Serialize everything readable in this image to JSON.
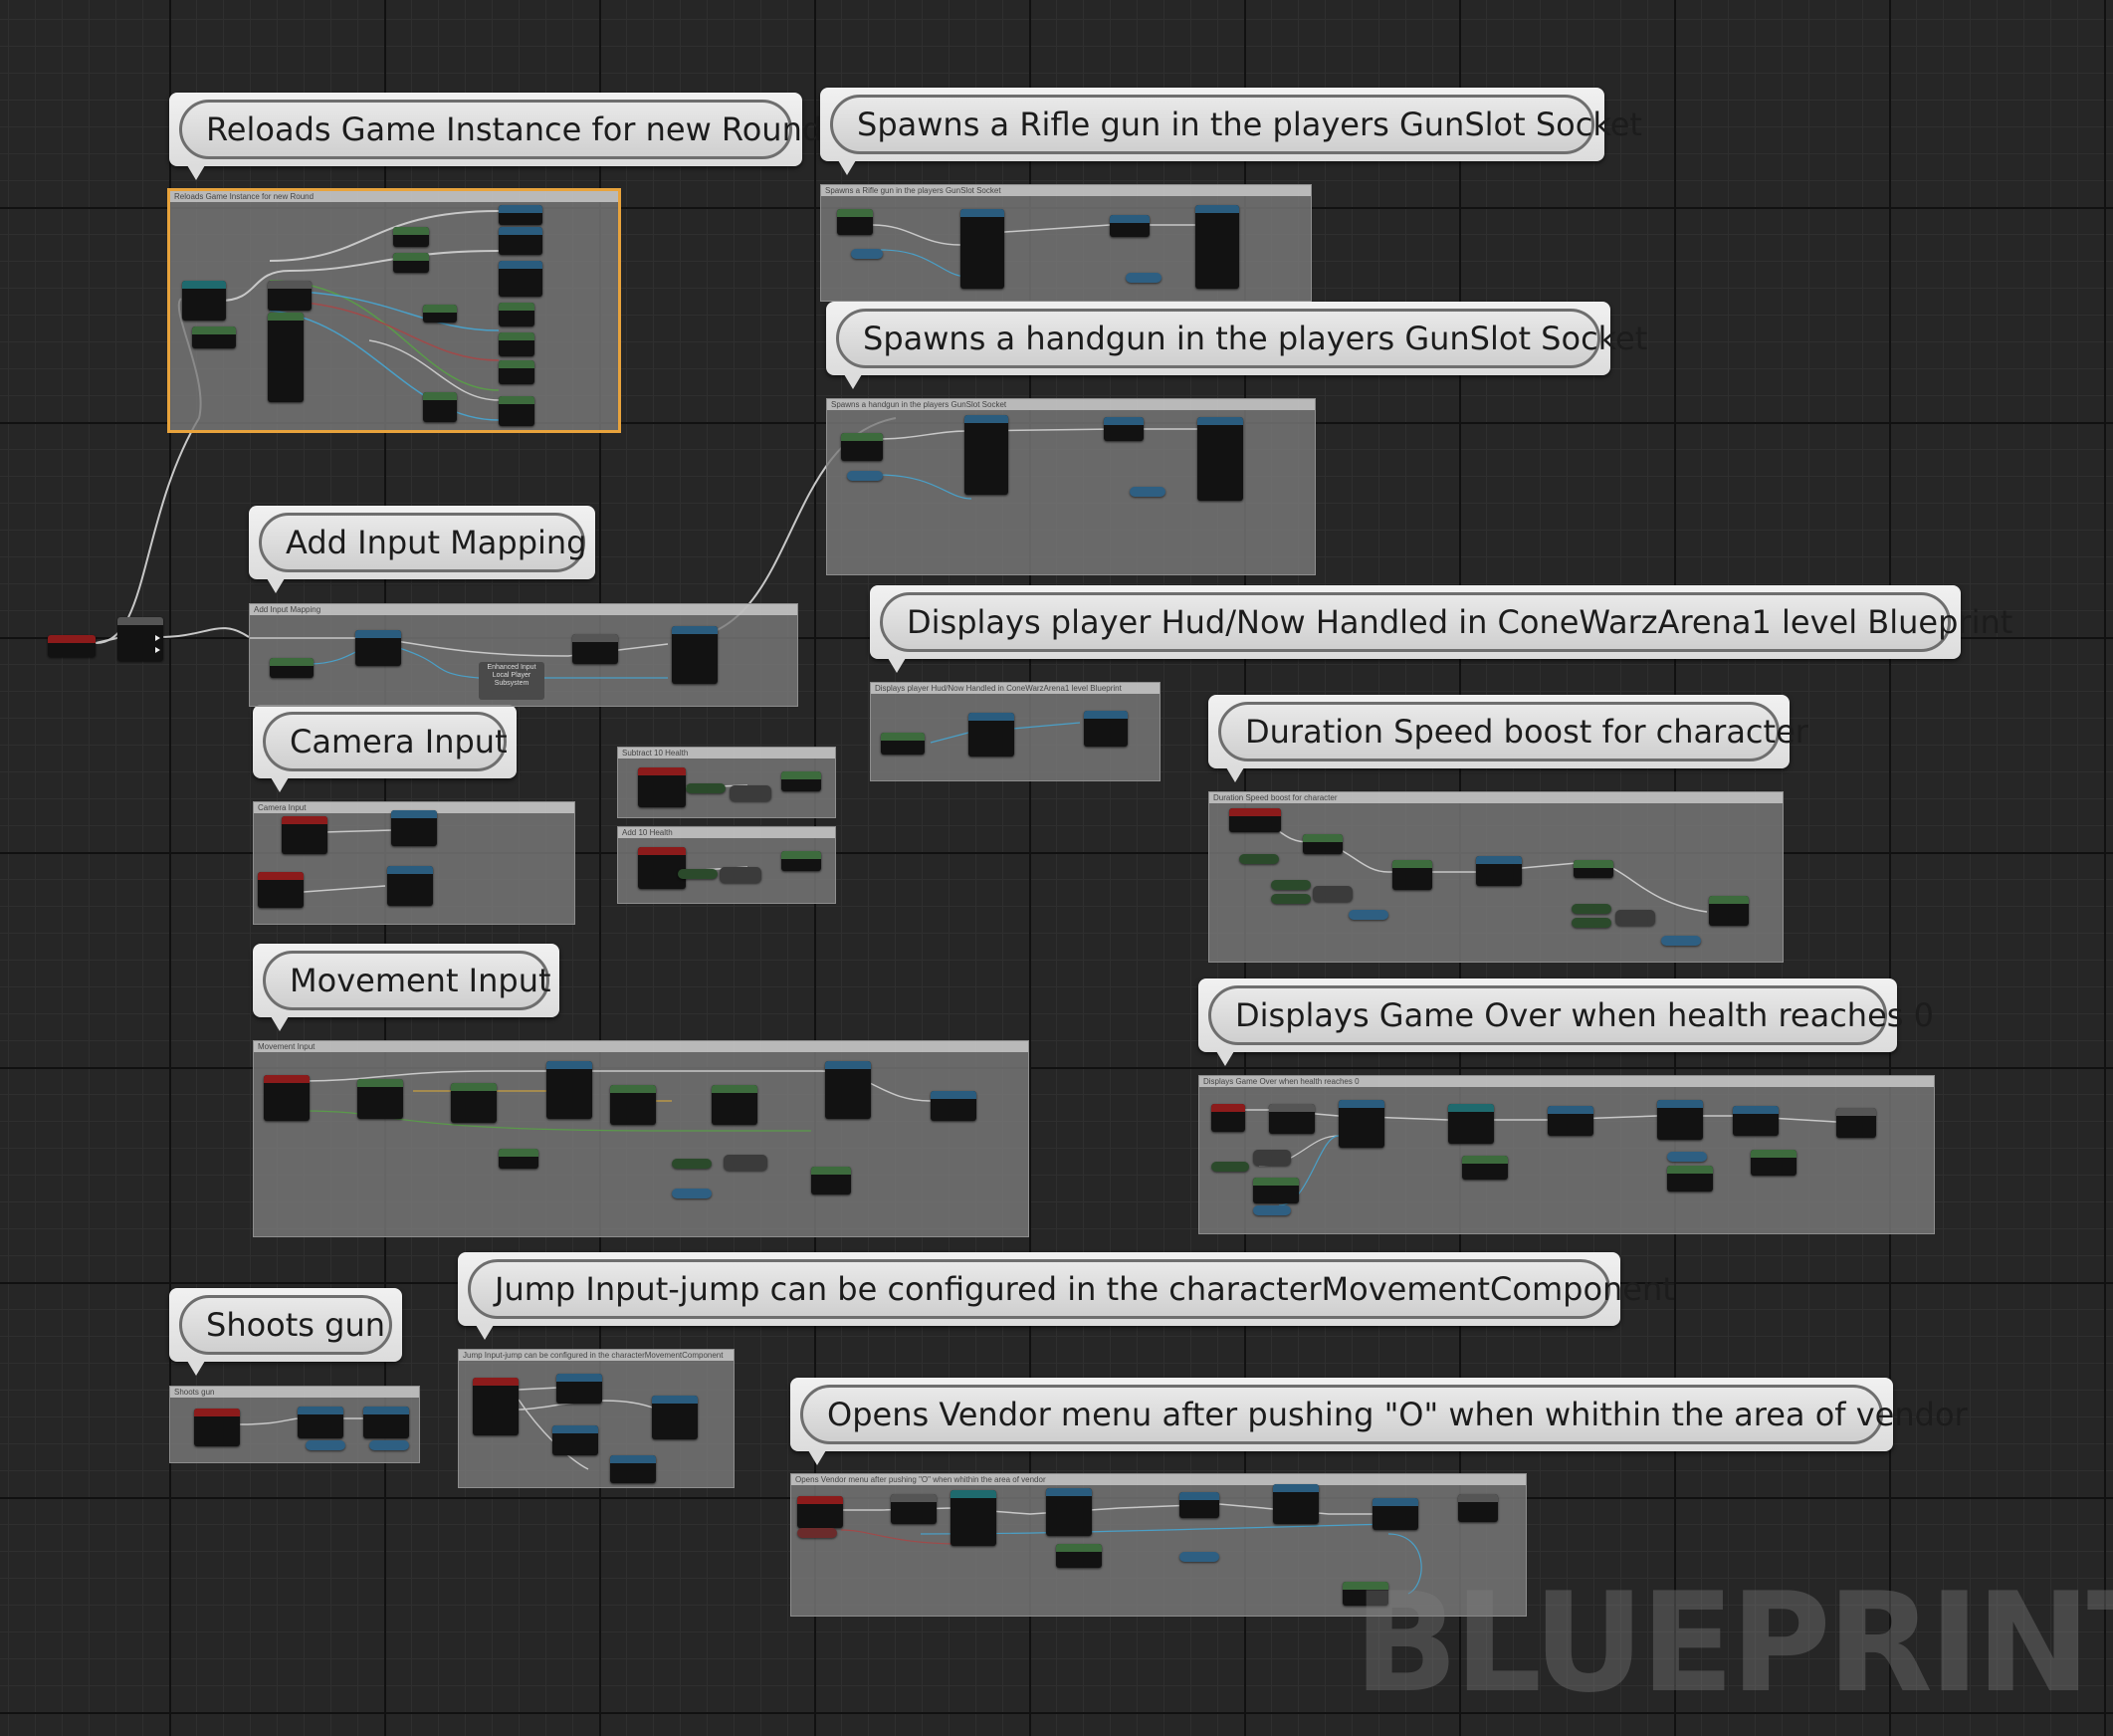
{
  "graph": {
    "watermark": "BLUEPRINT"
  },
  "comments": {
    "reload": {
      "label": "Reloads Game Instance for new Round",
      "panel_title": "Reloads Game Instance for new Round"
    },
    "rifle": {
      "label": "Spawns a Rifle gun in the players GunSlot Socket",
      "panel_title": "Spawns a Rifle gun in the players GunSlot Socket"
    },
    "handgun": {
      "label": "Spawns a handgun in the players GunSlot Socket",
      "panel_title": "Spawns a handgun in the players GunSlot Socket"
    },
    "input_mapping": {
      "label": "Add Input Mapping",
      "panel_title": "Add Input Mapping"
    },
    "hud": {
      "label": "Displays player Hud/Now Handled in ConeWarzArena1 level Blueprint",
      "panel_title": "Displays player Hud/Now Handled in ConeWarzArena1 level Blueprint"
    },
    "speed": {
      "label": "Duration Speed boost for character",
      "panel_title": "Duration Speed boost for character"
    },
    "camera": {
      "label": "Camera Input",
      "panel_title": "Camera Input"
    },
    "subtract_health": {
      "panel_title": "Subtract 10 Health"
    },
    "add_health": {
      "panel_title": "Add 10 Health"
    },
    "movement": {
      "label": "Movement Input",
      "panel_title": "Movement Input"
    },
    "game_over": {
      "label": "Displays Game Over when health reaches 0",
      "panel_title": "Displays Game Over when health reaches 0"
    },
    "shoot": {
      "label": "Shoots gun",
      "panel_title": "Shoots gun"
    },
    "jump": {
      "label": "Jump Input-jump can be configured in the characterMovementComponent",
      "panel_title": "Jump Input-jump can be configured in the characterMovementComponent"
    },
    "vendor": {
      "label": "Opens Vendor menu after pushing \"O\" when whithin the area of vendor",
      "panel_title": "Opens Vendor menu after pushing \"O\" when whithin the area of vendor"
    }
  },
  "nodes": {
    "enhanced_input_subsystem": "Enhanced Input Local Player Subsystem"
  },
  "colors": {
    "event_header": "#8c1b1b",
    "function_header": "#2a5c7e",
    "pure_header": "#3d6b3d",
    "cast_header": "#1f6a6e",
    "selected_outline": "#e8a33c"
  }
}
